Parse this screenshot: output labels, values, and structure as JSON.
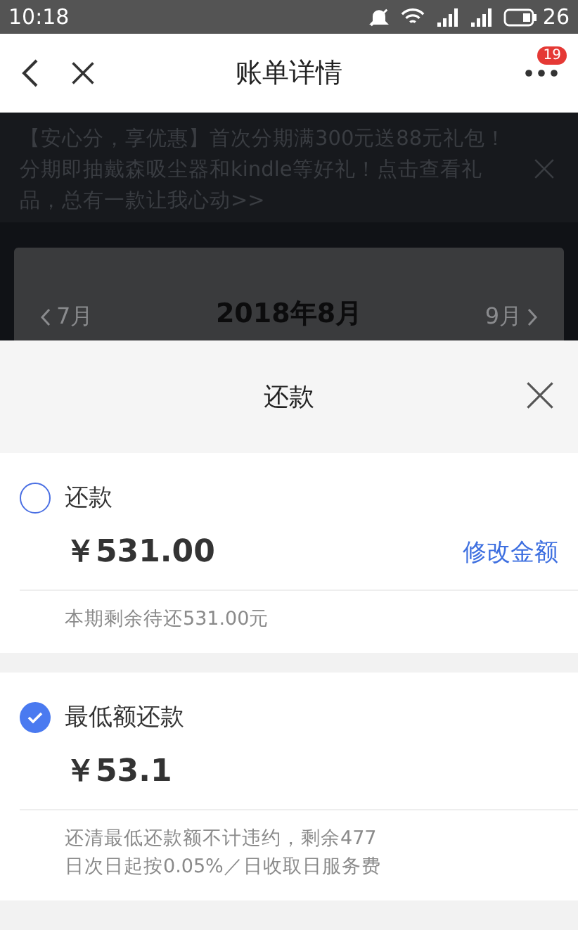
{
  "status_bar": {
    "time": "10:18",
    "battery": "26"
  },
  "header": {
    "title": "账单详情",
    "badge": "19"
  },
  "banner": {
    "text": "【安心分，享优惠】首次分期满300元送88元礼包！分期即抽戴森吸尘器和kindle等好礼！点击查看礼品，总有一款让我心动>>"
  },
  "month_nav": {
    "prev": "7月",
    "current": "2018年8月",
    "next": "9月"
  },
  "sheet": {
    "title": "还款",
    "options": [
      {
        "label": "还款",
        "amount": "￥531.00",
        "action": "修改金额",
        "note_lines": [
          "本期剩余待还531.00元"
        ],
        "selected": false
      },
      {
        "label": "最低额还款",
        "amount": "￥53.1",
        "note_lines": [
          "还清最低还款额不计违约，剩余477",
          "日次日起按0.05%／日收取日服务费"
        ],
        "selected": true
      }
    ]
  }
}
